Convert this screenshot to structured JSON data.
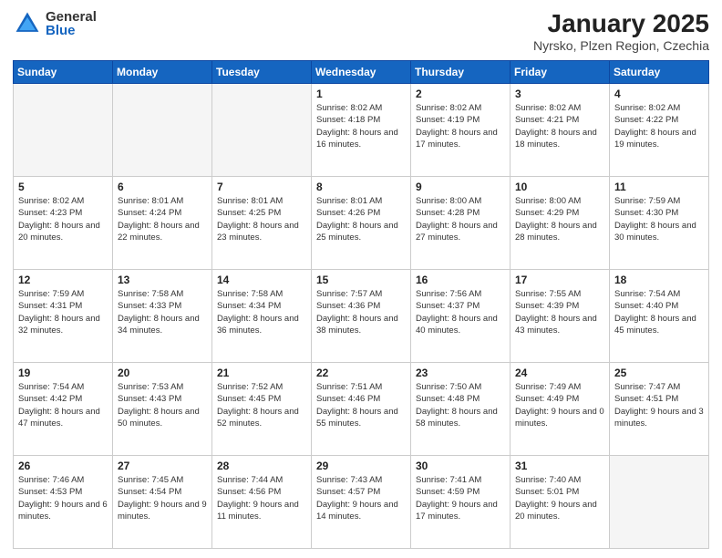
{
  "logo": {
    "general": "General",
    "blue": "Blue"
  },
  "title": "January 2025",
  "subtitle": "Nyrsko, Plzen Region, Czechia",
  "weekdays": [
    "Sunday",
    "Monday",
    "Tuesday",
    "Wednesday",
    "Thursday",
    "Friday",
    "Saturday"
  ],
  "weeks": [
    [
      {
        "day": "",
        "sunrise": "",
        "sunset": "",
        "daylight": ""
      },
      {
        "day": "",
        "sunrise": "",
        "sunset": "",
        "daylight": ""
      },
      {
        "day": "",
        "sunrise": "",
        "sunset": "",
        "daylight": ""
      },
      {
        "day": "1",
        "sunrise": "Sunrise: 8:02 AM",
        "sunset": "Sunset: 4:18 PM",
        "daylight": "Daylight: 8 hours and 16 minutes."
      },
      {
        "day": "2",
        "sunrise": "Sunrise: 8:02 AM",
        "sunset": "Sunset: 4:19 PM",
        "daylight": "Daylight: 8 hours and 17 minutes."
      },
      {
        "day": "3",
        "sunrise": "Sunrise: 8:02 AM",
        "sunset": "Sunset: 4:21 PM",
        "daylight": "Daylight: 8 hours and 18 minutes."
      },
      {
        "day": "4",
        "sunrise": "Sunrise: 8:02 AM",
        "sunset": "Sunset: 4:22 PM",
        "daylight": "Daylight: 8 hours and 19 minutes."
      }
    ],
    [
      {
        "day": "5",
        "sunrise": "Sunrise: 8:02 AM",
        "sunset": "Sunset: 4:23 PM",
        "daylight": "Daylight: 8 hours and 20 minutes."
      },
      {
        "day": "6",
        "sunrise": "Sunrise: 8:01 AM",
        "sunset": "Sunset: 4:24 PM",
        "daylight": "Daylight: 8 hours and 22 minutes."
      },
      {
        "day": "7",
        "sunrise": "Sunrise: 8:01 AM",
        "sunset": "Sunset: 4:25 PM",
        "daylight": "Daylight: 8 hours and 23 minutes."
      },
      {
        "day": "8",
        "sunrise": "Sunrise: 8:01 AM",
        "sunset": "Sunset: 4:26 PM",
        "daylight": "Daylight: 8 hours and 25 minutes."
      },
      {
        "day": "9",
        "sunrise": "Sunrise: 8:00 AM",
        "sunset": "Sunset: 4:28 PM",
        "daylight": "Daylight: 8 hours and 27 minutes."
      },
      {
        "day": "10",
        "sunrise": "Sunrise: 8:00 AM",
        "sunset": "Sunset: 4:29 PM",
        "daylight": "Daylight: 8 hours and 28 minutes."
      },
      {
        "day": "11",
        "sunrise": "Sunrise: 7:59 AM",
        "sunset": "Sunset: 4:30 PM",
        "daylight": "Daylight: 8 hours and 30 minutes."
      }
    ],
    [
      {
        "day": "12",
        "sunrise": "Sunrise: 7:59 AM",
        "sunset": "Sunset: 4:31 PM",
        "daylight": "Daylight: 8 hours and 32 minutes."
      },
      {
        "day": "13",
        "sunrise": "Sunrise: 7:58 AM",
        "sunset": "Sunset: 4:33 PM",
        "daylight": "Daylight: 8 hours and 34 minutes."
      },
      {
        "day": "14",
        "sunrise": "Sunrise: 7:58 AM",
        "sunset": "Sunset: 4:34 PM",
        "daylight": "Daylight: 8 hours and 36 minutes."
      },
      {
        "day": "15",
        "sunrise": "Sunrise: 7:57 AM",
        "sunset": "Sunset: 4:36 PM",
        "daylight": "Daylight: 8 hours and 38 minutes."
      },
      {
        "day": "16",
        "sunrise": "Sunrise: 7:56 AM",
        "sunset": "Sunset: 4:37 PM",
        "daylight": "Daylight: 8 hours and 40 minutes."
      },
      {
        "day": "17",
        "sunrise": "Sunrise: 7:55 AM",
        "sunset": "Sunset: 4:39 PM",
        "daylight": "Daylight: 8 hours and 43 minutes."
      },
      {
        "day": "18",
        "sunrise": "Sunrise: 7:54 AM",
        "sunset": "Sunset: 4:40 PM",
        "daylight": "Daylight: 8 hours and 45 minutes."
      }
    ],
    [
      {
        "day": "19",
        "sunrise": "Sunrise: 7:54 AM",
        "sunset": "Sunset: 4:42 PM",
        "daylight": "Daylight: 8 hours and 47 minutes."
      },
      {
        "day": "20",
        "sunrise": "Sunrise: 7:53 AM",
        "sunset": "Sunset: 4:43 PM",
        "daylight": "Daylight: 8 hours and 50 minutes."
      },
      {
        "day": "21",
        "sunrise": "Sunrise: 7:52 AM",
        "sunset": "Sunset: 4:45 PM",
        "daylight": "Daylight: 8 hours and 52 minutes."
      },
      {
        "day": "22",
        "sunrise": "Sunrise: 7:51 AM",
        "sunset": "Sunset: 4:46 PM",
        "daylight": "Daylight: 8 hours and 55 minutes."
      },
      {
        "day": "23",
        "sunrise": "Sunrise: 7:50 AM",
        "sunset": "Sunset: 4:48 PM",
        "daylight": "Daylight: 8 hours and 58 minutes."
      },
      {
        "day": "24",
        "sunrise": "Sunrise: 7:49 AM",
        "sunset": "Sunset: 4:49 PM",
        "daylight": "Daylight: 9 hours and 0 minutes."
      },
      {
        "day": "25",
        "sunrise": "Sunrise: 7:47 AM",
        "sunset": "Sunset: 4:51 PM",
        "daylight": "Daylight: 9 hours and 3 minutes."
      }
    ],
    [
      {
        "day": "26",
        "sunrise": "Sunrise: 7:46 AM",
        "sunset": "Sunset: 4:53 PM",
        "daylight": "Daylight: 9 hours and 6 minutes."
      },
      {
        "day": "27",
        "sunrise": "Sunrise: 7:45 AM",
        "sunset": "Sunset: 4:54 PM",
        "daylight": "Daylight: 9 hours and 9 minutes."
      },
      {
        "day": "28",
        "sunrise": "Sunrise: 7:44 AM",
        "sunset": "Sunset: 4:56 PM",
        "daylight": "Daylight: 9 hours and 11 minutes."
      },
      {
        "day": "29",
        "sunrise": "Sunrise: 7:43 AM",
        "sunset": "Sunset: 4:57 PM",
        "daylight": "Daylight: 9 hours and 14 minutes."
      },
      {
        "day": "30",
        "sunrise": "Sunrise: 7:41 AM",
        "sunset": "Sunset: 4:59 PM",
        "daylight": "Daylight: 9 hours and 17 minutes."
      },
      {
        "day": "31",
        "sunrise": "Sunrise: 7:40 AM",
        "sunset": "Sunset: 5:01 PM",
        "daylight": "Daylight: 9 hours and 20 minutes."
      },
      {
        "day": "",
        "sunrise": "",
        "sunset": "",
        "daylight": ""
      }
    ]
  ]
}
